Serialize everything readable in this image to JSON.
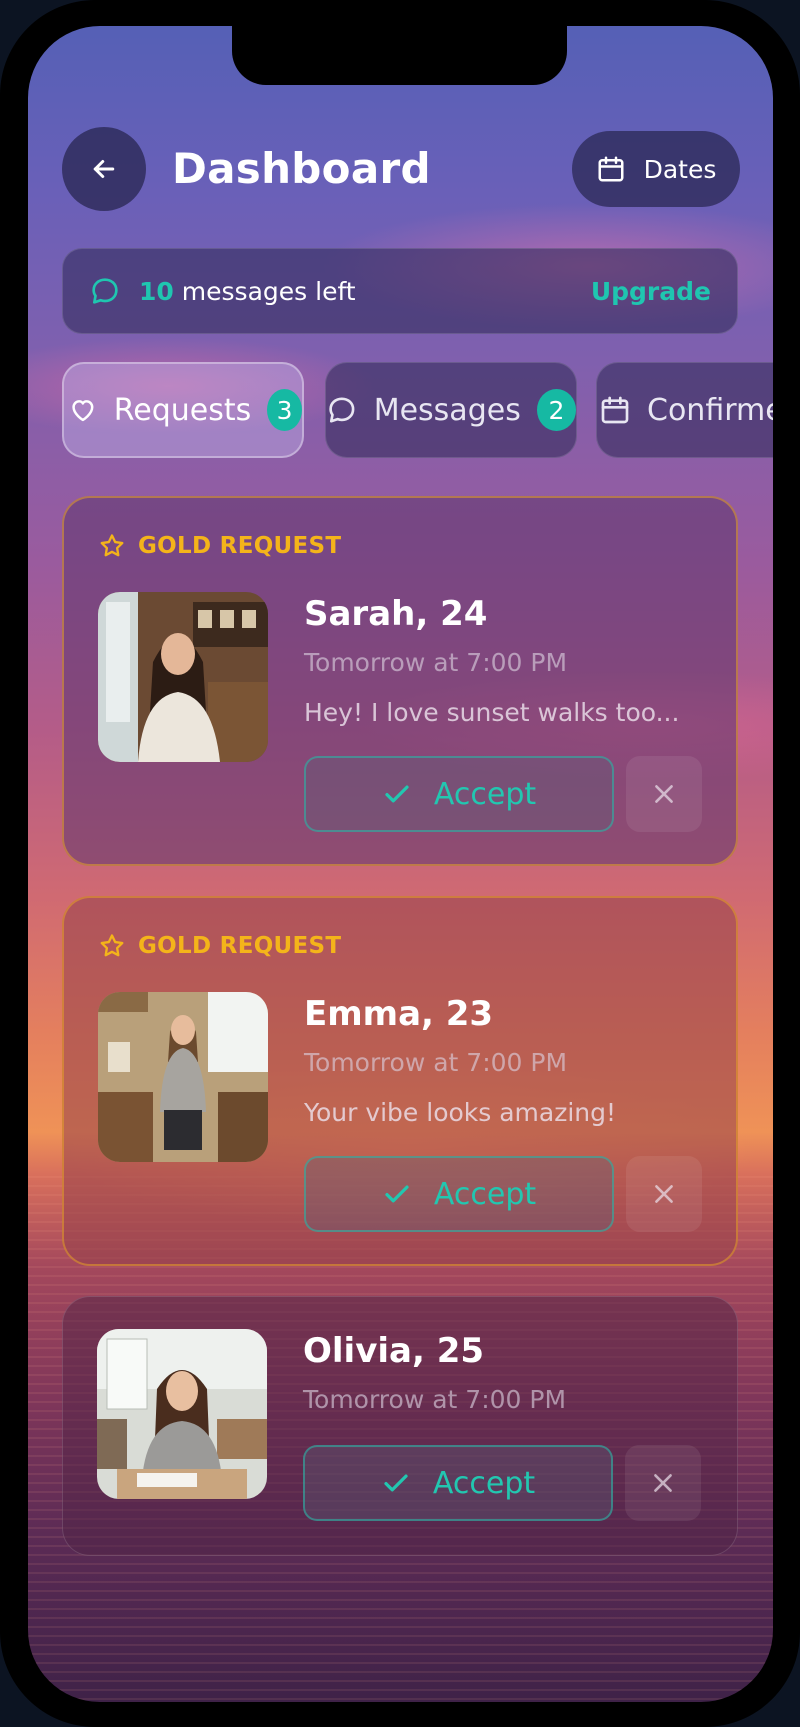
{
  "header": {
    "title": "Dashboard",
    "dates_label": "Dates"
  },
  "messages_bar": {
    "count": "10",
    "text": "messages left",
    "upgrade_label": "Upgrade"
  },
  "tabs": [
    {
      "label": "Requests",
      "badge": "3",
      "icon": "heart-icon",
      "active": true
    },
    {
      "label": "Messages",
      "badge": "2",
      "icon": "chat-icon",
      "active": false
    },
    {
      "label": "Confirmed",
      "badge": "",
      "icon": "calendar-icon",
      "active": false
    }
  ],
  "requests": [
    {
      "gold_label": "GOLD REQUEST",
      "name": "Sarah, 24",
      "time": "Tomorrow at 7:00 PM",
      "message": "Hey! I love sunset walks too...",
      "accept_label": "Accept"
    },
    {
      "gold_label": "GOLD REQUEST",
      "name": "Emma, 23",
      "time": "Tomorrow at 7:00 PM",
      "message": "Your vibe looks amazing!",
      "accept_label": "Accept"
    },
    {
      "name": "Olivia, 25",
      "time": "Tomorrow at 7:00 PM",
      "accept_label": "Accept"
    }
  ],
  "colors": {
    "accent_teal": "#1fc6b0",
    "gold": "#f4b41a",
    "badge": "#16b9a3"
  }
}
